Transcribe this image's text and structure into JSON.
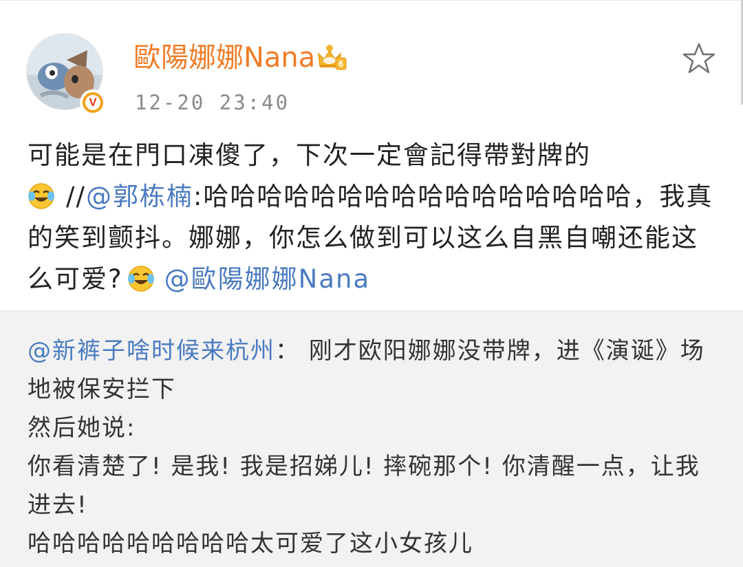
{
  "header": {
    "username": "歐陽娜娜Nana",
    "timestamp": "12-20 23:40",
    "vip_level": "6",
    "verified_mark": "V"
  },
  "post": {
    "line1": "可能是在門口凍傻了，下次一定會記得帶對牌的",
    "separator": "//",
    "mention1": "@郭栋楠",
    "quoted_text": ":哈哈哈哈哈哈哈哈哈哈哈哈哈哈哈哈，我真的笑到颤抖。娜娜，你怎么做到可以这么自黑自嘲还能这么可爱?",
    "mention2": "@歐陽娜娜Nana"
  },
  "repost": {
    "mention": "@新裤子啥时候来杭州",
    "text1": "： 刚才欧阳娜娜没带牌，进《演诞》场地被保安拦下",
    "line2": "然后她说:",
    "line3": "你看清楚了! 是我! 我是招娣儿! 摔碗那个! 你清醒一点，让我进去!",
    "line4": "哈哈哈哈哈哈哈哈哈太可爱了这小女孩儿"
  },
  "icons": {
    "favorite": "star-outline-icon",
    "emoji": "laughing-crying-emoji-icon",
    "vip": "crown-vip-icon",
    "verified": "verified-v-badge-icon"
  },
  "colors": {
    "username": "#f07b26",
    "mention": "#4a7ac0",
    "body_text": "#222222",
    "timestamp": "#8a8a8a",
    "repost_bg": "#f2f2f2"
  }
}
